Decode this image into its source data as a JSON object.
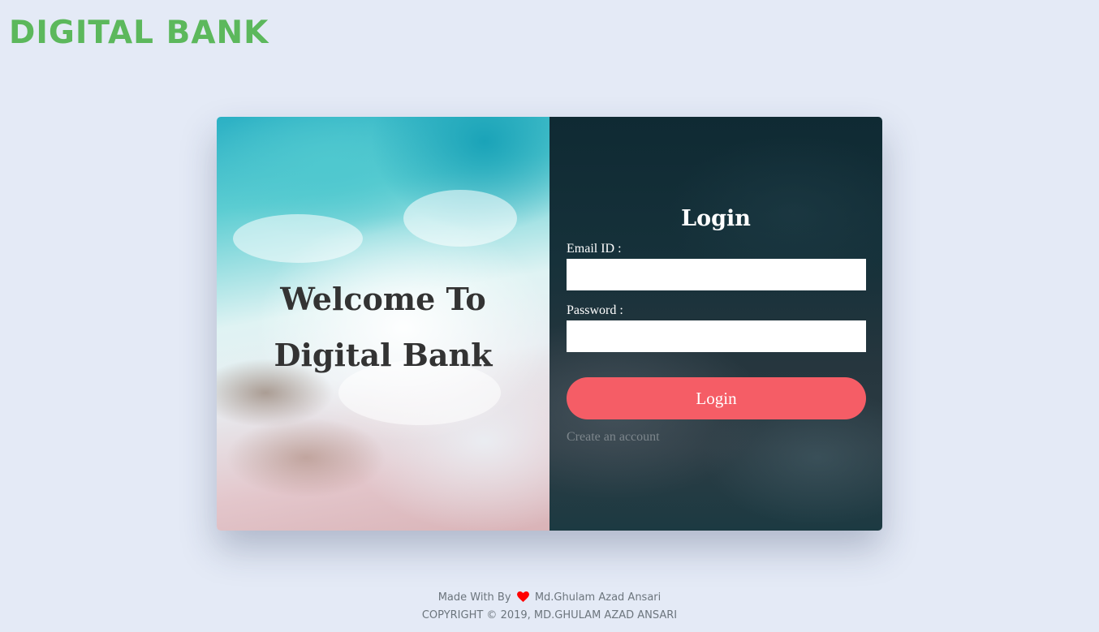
{
  "header": {
    "brand": "DIGITAL BANK"
  },
  "hero": {
    "welcome_text": "Welcome To Digital Bank"
  },
  "login_form": {
    "title": "Login",
    "email_label": "Email ID :",
    "email_value": "",
    "password_label": "Password :",
    "password_value": "",
    "submit_label": "Login",
    "create_account_label": "Create an account"
  },
  "footer": {
    "made_with_prefix": "Made With By",
    "author": "Md.Ghulam Azad Ansari",
    "copyright": "COPYRIGHT © 2019, MD.GHULAM AZAD ANSARI"
  },
  "colors": {
    "brand": "#5cb85c",
    "button": "#f55d66",
    "heart": "#ff0000",
    "background": "#e4eaf6"
  }
}
